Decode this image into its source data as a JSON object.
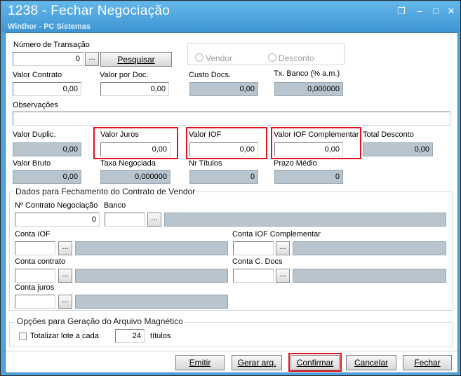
{
  "window": {
    "title": "1238 - Fechar Negociação",
    "subtitle": "Winthor - PC Sistemas"
  },
  "form": {
    "numero_transacao": {
      "label": "Número de Transação",
      "value": "0",
      "pesquisar_label": "Pesquisar"
    },
    "vendor_label": "Vendor",
    "desconto_label": "Desconto",
    "valor_contrato": {
      "label": "Valor Contrato",
      "value": "0,00"
    },
    "valor_por_doc": {
      "label": "Valor por Doc.",
      "value": "0,00"
    },
    "custo_docs": {
      "label": "Custo Docs.",
      "value": "0,00"
    },
    "tx_banco": {
      "label": "Tx. Banco (% a.m.)",
      "value": "0,000000"
    },
    "observacoes": {
      "label": "Observações",
      "value": ""
    },
    "valor_duplic": {
      "label": "Valor Duplic.",
      "value": "0,00"
    },
    "valor_juros": {
      "label": "Valor Juros",
      "value": "0,00"
    },
    "valor_iof": {
      "label": "Valor IOF",
      "value": "0,00"
    },
    "valor_iof_compl": {
      "label": "Valor IOF Complementar",
      "value": "0,00"
    },
    "total_desconto": {
      "label": "Total Desconto",
      "value": "0,00"
    },
    "valor_bruto": {
      "label": "Valor Bruto",
      "value": "0,00"
    },
    "taxa_negociada": {
      "label": "Taxa Negociada",
      "value": "0,000000"
    },
    "nr_titulos": {
      "label": "Nr Títulos",
      "value": "0"
    },
    "prazo_medio": {
      "label": "Prazo Médio",
      "value": "0"
    }
  },
  "fechamento": {
    "title": "Dados para Fechamento do Contrato de Vendor",
    "contrato_negociacao": {
      "label": "Nº Contrato Negociação",
      "value": "0"
    },
    "banco_label": "Banco",
    "conta_iof_label": "Conta IOF",
    "conta_iof_compl_label": "Conta IOF Complementar",
    "conta_contrato_label": "Conta contrato",
    "conta_c_docs_label": "Conta C. Docs",
    "conta_juros_label": "Conta juros",
    "ellipsis": "..."
  },
  "opcoes": {
    "title": "Opções para Geração do Arquivo Magnético",
    "totalizar_label": "Totalizar lote a cada",
    "lote_value": "24",
    "titulos_label": "títulos"
  },
  "buttons": {
    "emitir": "Emitir",
    "gerar_arq": "Gerar arq.",
    "confirmar": "Confirmar",
    "cancelar": "Cancelar",
    "fechar": "Fechar"
  }
}
